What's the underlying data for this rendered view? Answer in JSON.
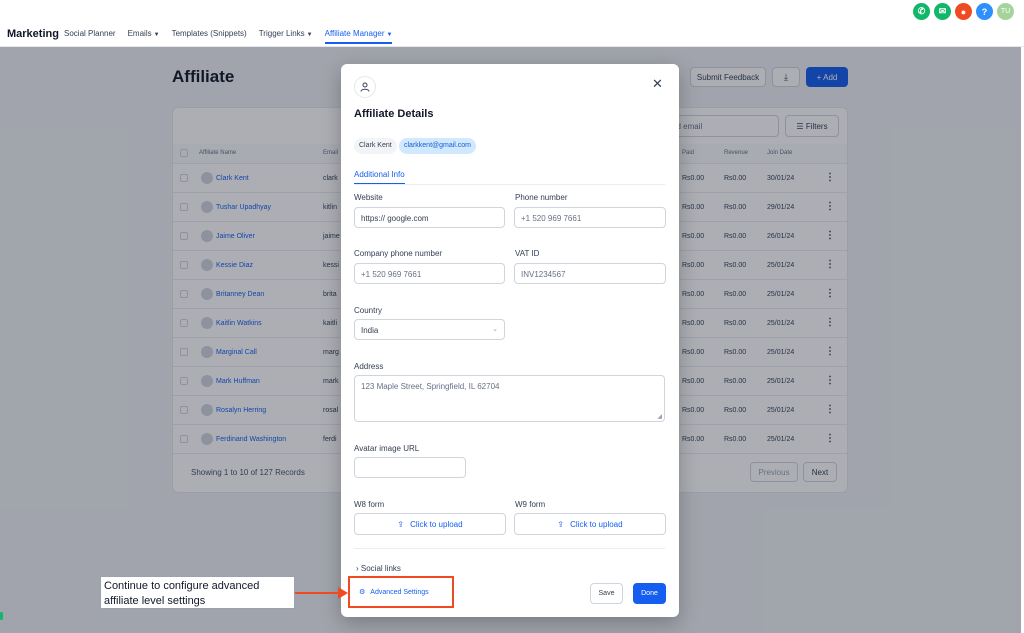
{
  "topbar": {
    "brand": "Marketing",
    "nav": [
      {
        "label": "Social Planner",
        "dropdown": false,
        "active": false
      },
      {
        "label": "Emails",
        "dropdown": true,
        "active": false
      },
      {
        "label": "Templates (Snippets)",
        "dropdown": false,
        "active": false
      },
      {
        "label": "Trigger Links",
        "dropdown": true,
        "active": false
      },
      {
        "label": "Affiliate Manager",
        "dropdown": true,
        "active": true
      }
    ],
    "icons": [
      {
        "name": "phone-icon",
        "color": "#12b76a",
        "glyph": "✆"
      },
      {
        "name": "megaphone-icon",
        "color": "#12b76a",
        "glyph": "✉"
      },
      {
        "name": "notification-icon",
        "color": "#f04a23",
        "glyph": "●"
      },
      {
        "name": "help-icon",
        "color": "#2e90fa",
        "glyph": "?"
      },
      {
        "name": "user-avatar",
        "color": "#a6d39a",
        "glyph": "TU"
      }
    ]
  },
  "page": {
    "title": "Affiliate",
    "feedback_label": "Submit Feedback",
    "add_label": "+ Add",
    "search_placeholder": "nd email",
    "filters_label": "Filters",
    "columns": {
      "name": "Affiliate Name",
      "email": "Email",
      "paid": "Paid",
      "revenue": "Revenue",
      "join": "Join Date"
    },
    "rows": [
      {
        "name": "Clark Kent",
        "email": "clark",
        "paid": "Rs0.00",
        "revenue": "Rs0.00",
        "date": "30/01/24"
      },
      {
        "name": "Tushar Upadhyay",
        "email": "kitlin",
        "paid": "Rs0.00",
        "revenue": "Rs0.00",
        "date": "29/01/24"
      },
      {
        "name": "Jaime Oliver",
        "email": "jaime",
        "paid": "Rs0.00",
        "revenue": "Rs0.00",
        "date": "26/01/24"
      },
      {
        "name": "Kessie Diaz",
        "email": "kessi",
        "paid": "Rs0.00",
        "revenue": "Rs0.00",
        "date": "25/01/24"
      },
      {
        "name": "Britanney Dean",
        "email": "brita",
        "paid": "Rs0.00",
        "revenue": "Rs0.00",
        "date": "25/01/24"
      },
      {
        "name": "Kaitlin Watkins",
        "email": "kaitli",
        "paid": "Rs0.00",
        "revenue": "Rs0.00",
        "date": "25/01/24"
      },
      {
        "name": "Marginal Call",
        "email": "marg",
        "paid": "Rs0.00",
        "revenue": "Rs0.00",
        "date": "25/01/24"
      },
      {
        "name": "Mark Huffman",
        "email": "mark",
        "paid": "Rs0.00",
        "revenue": "Rs0.00",
        "date": "25/01/24"
      },
      {
        "name": "Rosalyn Herring",
        "email": "rosal",
        "paid": "Rs0.00",
        "revenue": "Rs0.00",
        "date": "25/01/24"
      },
      {
        "name": "Ferdinand Washington",
        "email": "ferdi",
        "paid": "Rs0.00",
        "revenue": "Rs0.00",
        "date": "25/01/24"
      }
    ],
    "showing": "Showing 1 to 10 of 127 Records",
    "prev_label": "Previous",
    "next_label": "Next"
  },
  "modal": {
    "title": "Affiliate Details",
    "chip_name": "Clark Kent",
    "chip_email": "clarkkent@gmail.com",
    "tab": "Additional Info",
    "website": {
      "label": "Website",
      "value": "https:// google.com"
    },
    "phone": {
      "label": "Phone number",
      "placeholder": "+1 520 969 7661"
    },
    "company_phone": {
      "label": "Company phone number",
      "placeholder": "+1 520 969 7661"
    },
    "vat": {
      "label": "VAT ID",
      "placeholder": "INV1234567"
    },
    "country": {
      "label": "Country",
      "value": "India"
    },
    "address": {
      "label": "Address",
      "placeholder": "123 Maple Street, Springfield, IL 62704"
    },
    "avatar_url": {
      "label": "Avatar image URL",
      "value": ""
    },
    "w8": {
      "label": "W8 form",
      "upload": "Click to upload"
    },
    "w9": {
      "label": "W9 form",
      "upload": "Click to upload"
    },
    "social_links": "Social links",
    "advanced_settings": "Advanced Settings",
    "save": "Save",
    "done": "Done",
    "accent_color": "#155eef"
  },
  "annotation": {
    "text_line1": "Continue to configure advanced",
    "text_line2": "affiliate level settings",
    "color": "#f04a23"
  }
}
